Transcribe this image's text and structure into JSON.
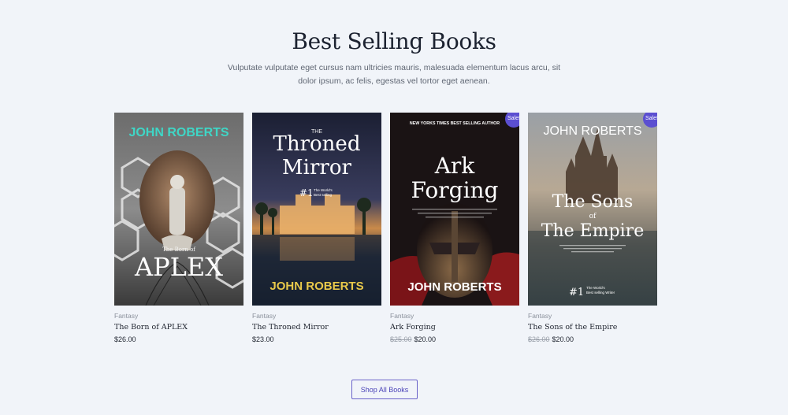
{
  "section": {
    "title": "Best Selling Books",
    "description": "Vulputate vulputate eget cursus nam ultricies mauris, malesuada elementum lacus arcu, sit dolor ipsum, ac felis, egestas vel tortor eget aenean."
  },
  "products": [
    {
      "category": "Fantasy",
      "name": "The Born of APLEX",
      "price": "$26.00",
      "old_price": "",
      "badge": "",
      "cover": {
        "author": "JOHN ROBERTS",
        "subtitle": "The Born of",
        "title": "APLEX"
      }
    },
    {
      "category": "Fantasy",
      "name": "The Throned Mirror",
      "price": "$23.00",
      "old_price": "",
      "badge": "",
      "cover": {
        "small": "THE",
        "title_1": "Throned",
        "title_2": "Mirror",
        "rank": "#1",
        "rank_line_1": "The World's",
        "rank_line_2": "Best selling",
        "author": "JOHN ROBERTS"
      }
    },
    {
      "category": "Fantasy",
      "name": "Ark Forging",
      "price": "$20.00",
      "old_price": "$25.00",
      "badge": "Sale!",
      "cover": {
        "tagline": "NEW YORKS TIMES BEST SELLING AUTHOR",
        "title_1": "Ark",
        "title_2": "Forging",
        "author": "JOHN ROBERTS"
      }
    },
    {
      "category": "Fantasy",
      "name": "The Sons of the Empire",
      "price": "$20.00",
      "old_price": "$26.00",
      "badge": "Sale!",
      "cover": {
        "author": "JOHN ROBERTS",
        "title_1": "The Sons",
        "title_2": "of",
        "title_3": "The Empire",
        "rank": "#1",
        "rank_line_1": "The World's",
        "rank_line_2": "Best selling Writer"
      }
    }
  ],
  "cta": {
    "label": "Shop All Books"
  },
  "colors": {
    "accent": "#5b4fd1",
    "background": "#f1f4f9",
    "cyan": "#3fd6c6",
    "gold": "#e9c94a"
  }
}
